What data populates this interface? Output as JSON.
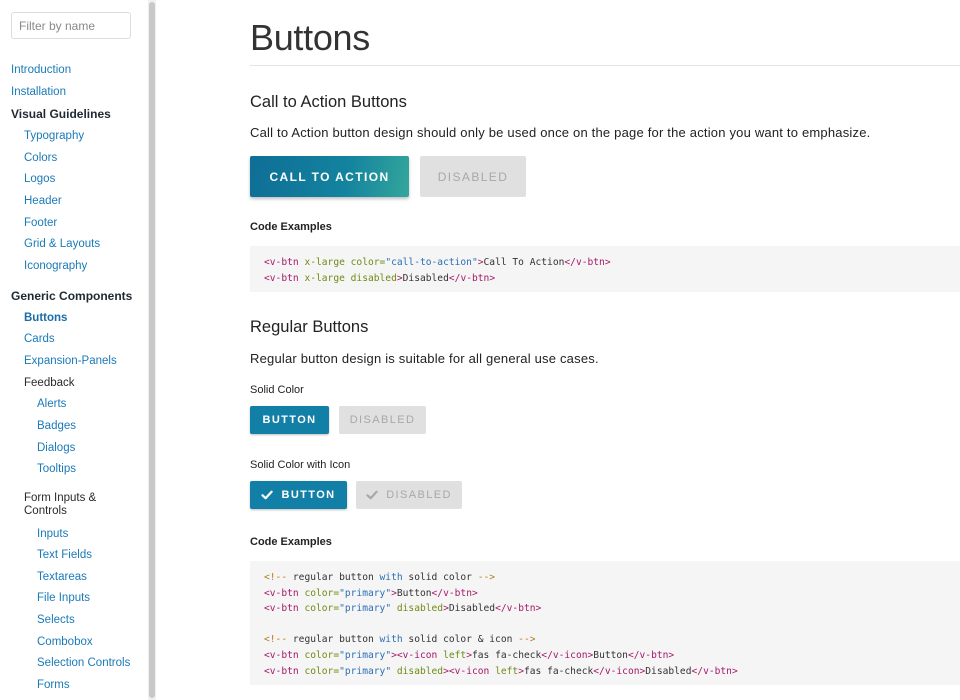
{
  "sidebar": {
    "filter_placeholder": "Filter by name",
    "items": [
      {
        "label": "Introduction",
        "type": "link"
      },
      {
        "label": "Installation",
        "type": "link"
      },
      {
        "label": "Visual Guidelines",
        "type": "heading"
      },
      {
        "label": "Typography",
        "type": "link"
      },
      {
        "label": "Colors",
        "type": "link"
      },
      {
        "label": "Logos",
        "type": "link"
      },
      {
        "label": "Header",
        "type": "link"
      },
      {
        "label": "Footer",
        "type": "link"
      },
      {
        "label": "Grid & Layouts",
        "type": "link"
      },
      {
        "label": "Iconography",
        "type": "link"
      },
      {
        "label": "Generic Components",
        "type": "heading"
      },
      {
        "label": "Buttons",
        "type": "link",
        "active": true
      },
      {
        "label": "Cards",
        "type": "link"
      },
      {
        "label": "Expansion-Panels",
        "type": "link"
      },
      {
        "label": "Feedback",
        "type": "group"
      },
      {
        "label": "Alerts",
        "type": "link"
      },
      {
        "label": "Badges",
        "type": "link"
      },
      {
        "label": "Dialogs",
        "type": "link"
      },
      {
        "label": "Tooltips",
        "type": "link"
      },
      {
        "label": "Form Inputs & Controls",
        "type": "group"
      },
      {
        "label": "Inputs",
        "type": "link"
      },
      {
        "label": "Text Fields",
        "type": "link"
      },
      {
        "label": "Textareas",
        "type": "link"
      },
      {
        "label": "File Inputs",
        "type": "link"
      },
      {
        "label": "Selects",
        "type": "link"
      },
      {
        "label": "Combobox",
        "type": "link"
      },
      {
        "label": "Selection Controls",
        "type": "link"
      },
      {
        "label": "Forms",
        "type": "link"
      }
    ]
  },
  "main": {
    "title": "Buttons",
    "cta_section": {
      "heading": "Call to Action Buttons",
      "description": "Call to Action button design should only be used once on the page for the action you want to emphasize.",
      "cta_button": "Call To Action",
      "disabled_button": "Disabled",
      "code_label": "Code Examples",
      "code": [
        [
          {
            "t": "<",
            "c": "tag"
          },
          {
            "t": "v-btn",
            "c": "tag"
          },
          {
            "t": " x-large color=",
            "c": "attr"
          },
          {
            "t": "\"call-to-action\"",
            "c": "str"
          },
          {
            "t": ">",
            "c": "tag"
          },
          {
            "t": "Call To Action",
            "c": "txt"
          },
          {
            "t": "</",
            "c": "tag"
          },
          {
            "t": "v-btn",
            "c": "tag"
          },
          {
            "t": ">",
            "c": "tag"
          }
        ],
        [
          {
            "t": "<",
            "c": "tag"
          },
          {
            "t": "v-btn",
            "c": "tag"
          },
          {
            "t": " x-large disabled",
            "c": "attr"
          },
          {
            "t": ">",
            "c": "tag"
          },
          {
            "t": "Disabled",
            "c": "txt"
          },
          {
            "t": "</",
            "c": "tag"
          },
          {
            "t": "v-btn",
            "c": "tag"
          },
          {
            "t": ">",
            "c": "tag"
          }
        ]
      ]
    },
    "regular_section": {
      "heading": "Regular Buttons",
      "description": "Regular button design is suitable for all general use cases.",
      "solid_label": "Solid Color",
      "button": "Button",
      "disabled_button": "Disabled",
      "icon_label": "Solid Color with Icon",
      "icon_button": "Button",
      "icon_disabled_button": "Disabled",
      "icon_name": "check-icon",
      "code_label": "Code Examples",
      "code": [
        [
          {
            "t": "<!-- ",
            "c": "com"
          },
          {
            "t": "regular button ",
            "c": "txt"
          },
          {
            "t": "with",
            "c": "kw"
          },
          {
            "t": " solid color ",
            "c": "txt"
          },
          {
            "t": "-->",
            "c": "com"
          }
        ],
        [
          {
            "t": "<",
            "c": "tag"
          },
          {
            "t": "v-btn",
            "c": "tag"
          },
          {
            "t": " color=",
            "c": "attr"
          },
          {
            "t": "\"primary\"",
            "c": "str"
          },
          {
            "t": ">",
            "c": "tag"
          },
          {
            "t": "Button",
            "c": "txt"
          },
          {
            "t": "</",
            "c": "tag"
          },
          {
            "t": "v-btn",
            "c": "tag"
          },
          {
            "t": ">",
            "c": "tag"
          }
        ],
        [
          {
            "t": "<",
            "c": "tag"
          },
          {
            "t": "v-btn",
            "c": "tag"
          },
          {
            "t": " color=",
            "c": "attr"
          },
          {
            "t": "\"primary\"",
            "c": "str"
          },
          {
            "t": " disabled",
            "c": "attr"
          },
          {
            "t": ">",
            "c": "tag"
          },
          {
            "t": "Disabled",
            "c": "txt"
          },
          {
            "t": "</",
            "c": "tag"
          },
          {
            "t": "v-btn",
            "c": "tag"
          },
          {
            "t": ">",
            "c": "tag"
          }
        ],
        [],
        [
          {
            "t": "<!-- ",
            "c": "com"
          },
          {
            "t": "regular button ",
            "c": "txt"
          },
          {
            "t": "with",
            "c": "kw"
          },
          {
            "t": " solid color & icon ",
            "c": "txt"
          },
          {
            "t": "-->",
            "c": "com"
          }
        ],
        [
          {
            "t": "<",
            "c": "tag"
          },
          {
            "t": "v-btn",
            "c": "tag"
          },
          {
            "t": " color=",
            "c": "attr"
          },
          {
            "t": "\"primary\"",
            "c": "str"
          },
          {
            "t": ">",
            "c": "tag"
          },
          {
            "t": "<",
            "c": "tag"
          },
          {
            "t": "v-icon",
            "c": "tag"
          },
          {
            "t": " left",
            "c": "attr"
          },
          {
            "t": ">",
            "c": "tag"
          },
          {
            "t": "fas fa-check",
            "c": "txt"
          },
          {
            "t": "</",
            "c": "tag"
          },
          {
            "t": "v-icon",
            "c": "tag"
          },
          {
            "t": ">",
            "c": "tag"
          },
          {
            "t": "Button",
            "c": "txt"
          },
          {
            "t": "</",
            "c": "tag"
          },
          {
            "t": "v-btn",
            "c": "tag"
          },
          {
            "t": ">",
            "c": "tag"
          }
        ],
        [
          {
            "t": "<",
            "c": "tag"
          },
          {
            "t": "v-btn",
            "c": "tag"
          },
          {
            "t": " color=",
            "c": "attr"
          },
          {
            "t": "\"primary\"",
            "c": "str"
          },
          {
            "t": " disabled",
            "c": "attr"
          },
          {
            "t": ">",
            "c": "tag"
          },
          {
            "t": "<",
            "c": "tag"
          },
          {
            "t": "v-icon",
            "c": "tag"
          },
          {
            "t": " left",
            "c": "attr"
          },
          {
            "t": ">",
            "c": "tag"
          },
          {
            "t": "fas fa-check",
            "c": "txt"
          },
          {
            "t": "</",
            "c": "tag"
          },
          {
            "t": "v-icon",
            "c": "tag"
          },
          {
            "t": ">",
            "c": "tag"
          },
          {
            "t": "Disabled",
            "c": "txt"
          },
          {
            "t": "</",
            "c": "tag"
          },
          {
            "t": "v-btn",
            "c": "tag"
          },
          {
            "t": ">",
            "c": "tag"
          }
        ]
      ]
    }
  },
  "colors": {
    "primary": "#127fa6",
    "link": "#1a7ab8",
    "disabled_bg": "#e0e0e0",
    "disabled_text": "#a8a8a8"
  }
}
